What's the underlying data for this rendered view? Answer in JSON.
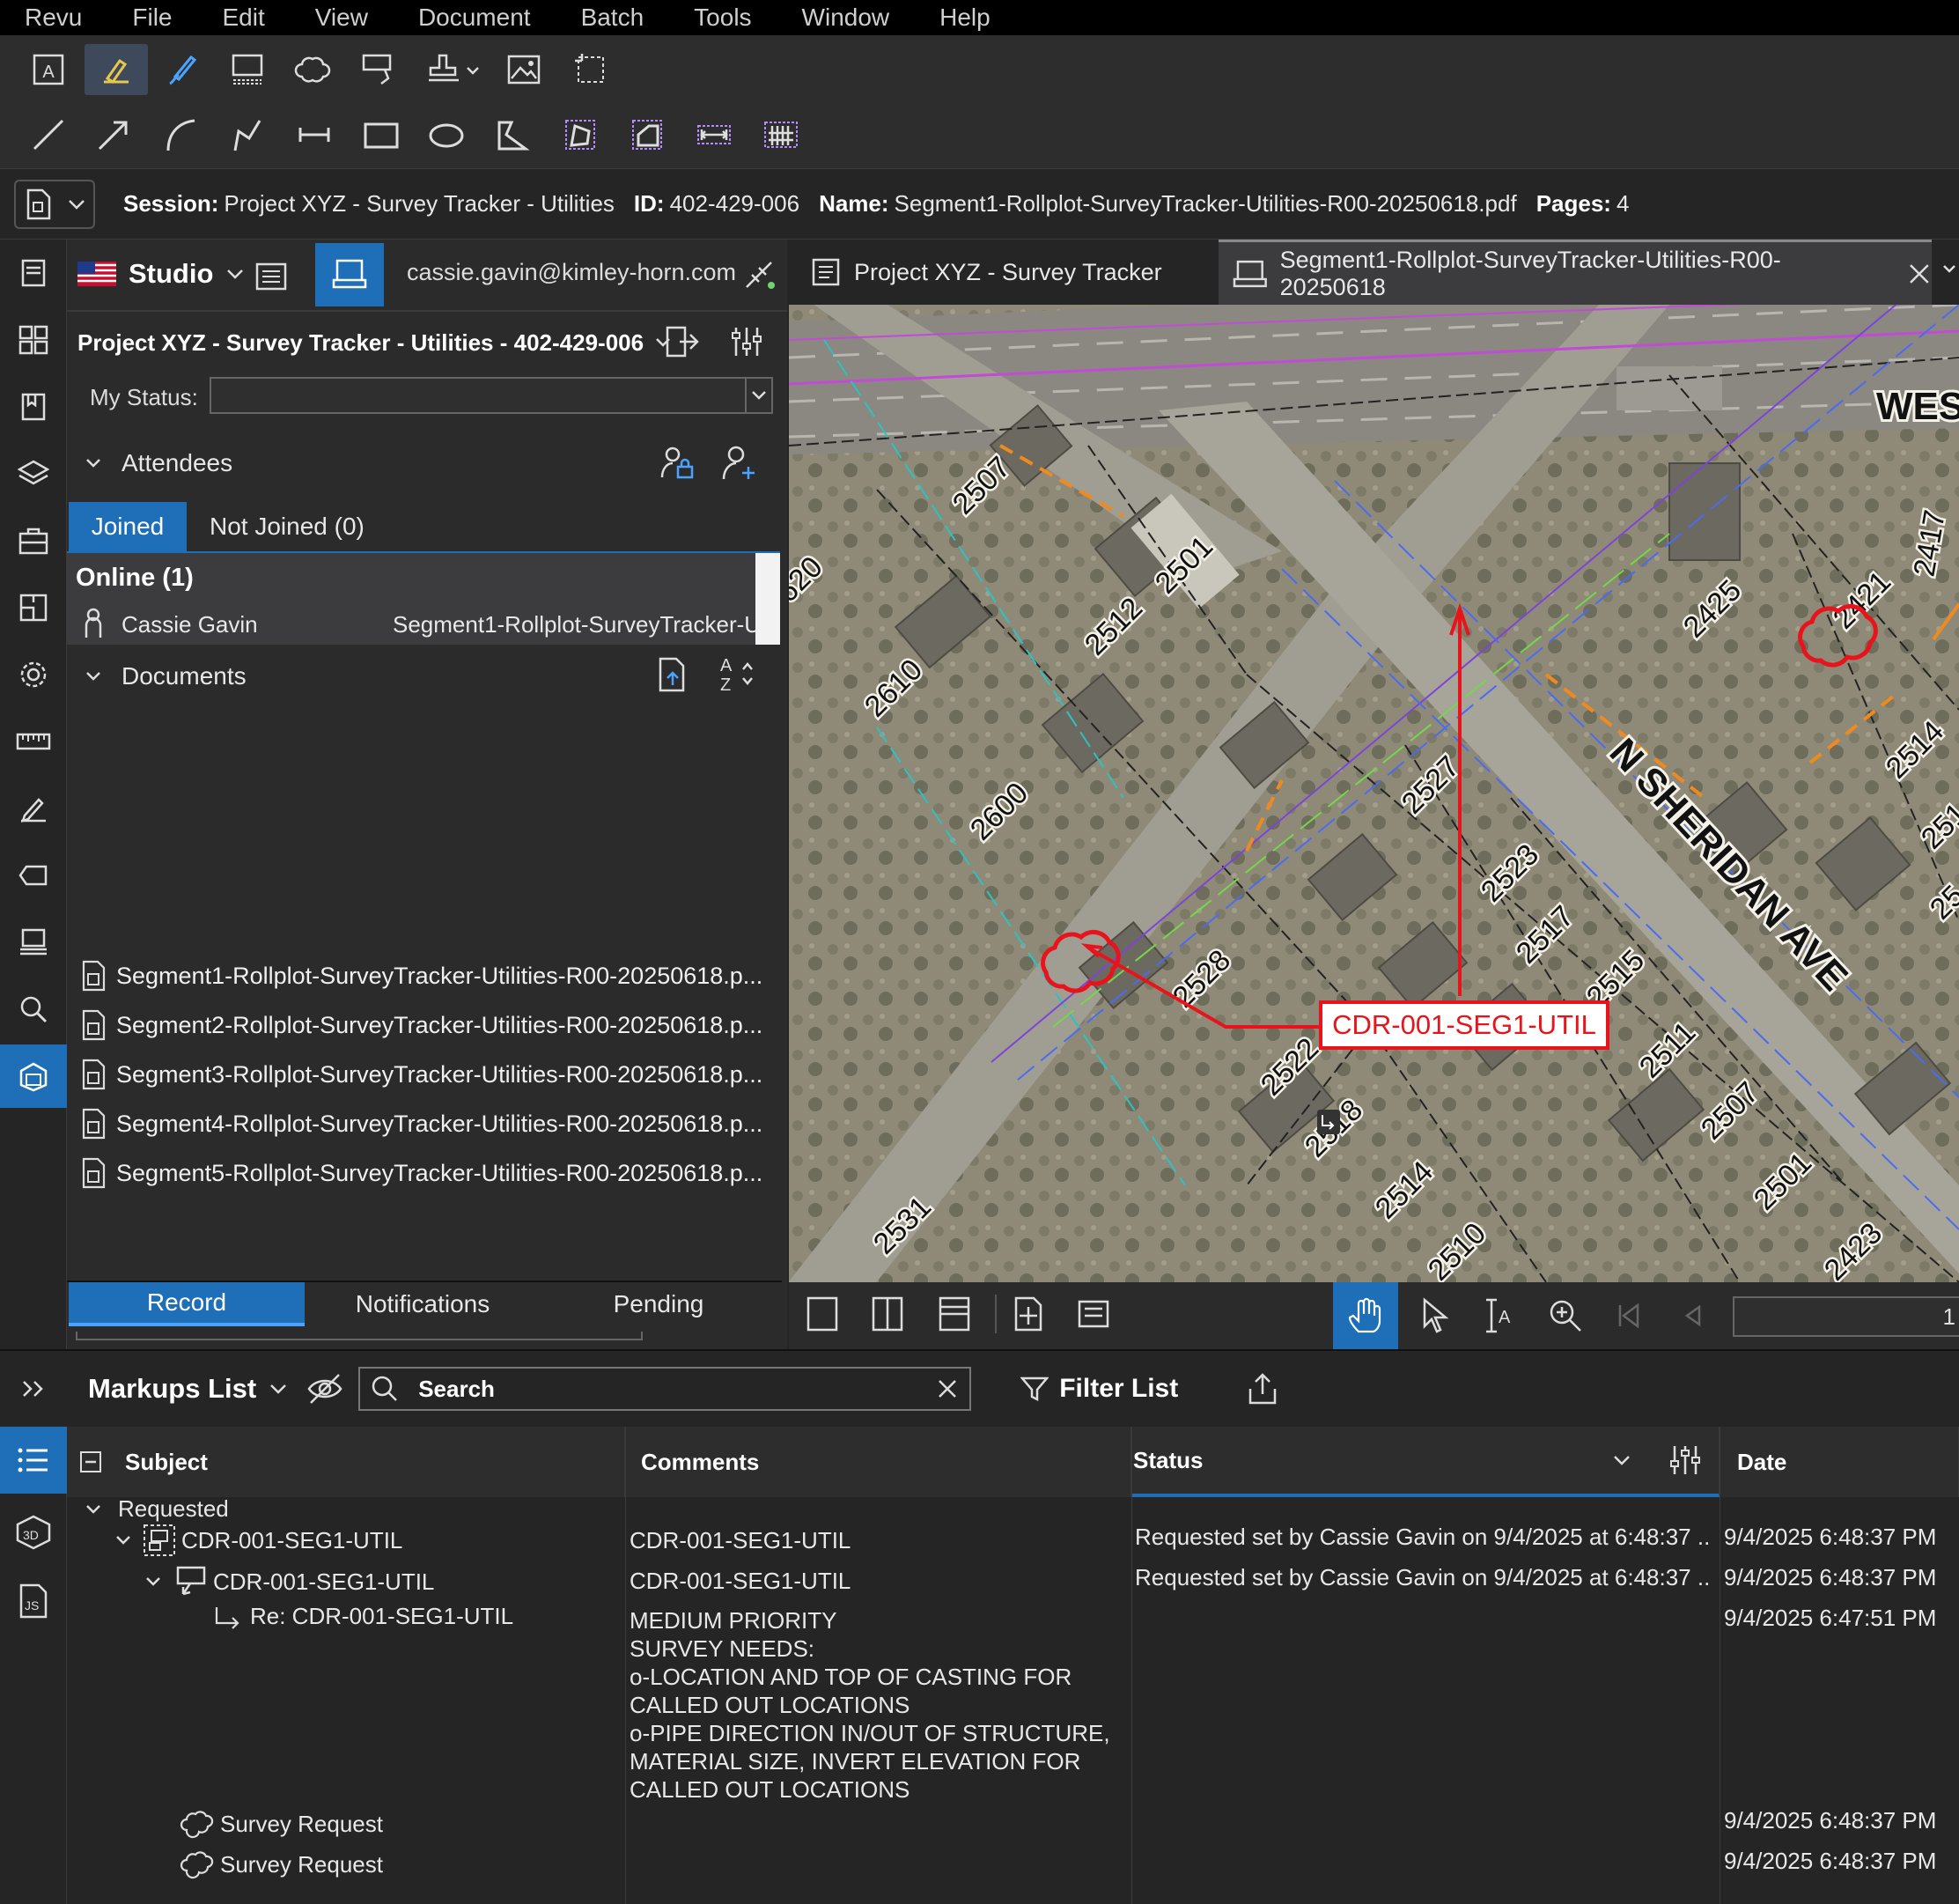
{
  "menu": [
    "Revu",
    "File",
    "Edit",
    "View",
    "Document",
    "Batch",
    "Tools",
    "Window",
    "Help"
  ],
  "info": {
    "session_label": "Session:",
    "session": "Project XYZ - Survey Tracker - Utilities",
    "id_label": "ID:",
    "id": "402-429-006",
    "name_label": "Name:",
    "name": "Segment1-Rollplot-SurveyTracker-Utilities-R00-20250618.pdf",
    "pages_label": "Pages:",
    "pages": "4"
  },
  "studio": {
    "title": "Studio",
    "user": "cassie.gavin@kimley-horn.com",
    "project": "Project XYZ - Survey Tracker - Utilities - 402-429-006",
    "my_status_label": "My Status:",
    "my_status_value": "",
    "attendees_label": "Attendees",
    "joined_tab": "Joined",
    "not_joined_tab": "Not Joined (0)",
    "online_header": "Online (1)",
    "attendee_name": "Cassie Gavin",
    "attendee_doc": "Segment1-Rollplot-SurveyTracker-U",
    "documents_label": "Documents",
    "documents": [
      "Segment1-Rollplot-SurveyTracker-Utilities-R00-20250618.p...",
      "Segment2-Rollplot-SurveyTracker-Utilities-R00-20250618.p...",
      "Segment3-Rollplot-SurveyTracker-Utilities-R00-20250618.p...",
      "Segment4-Rollplot-SurveyTracker-Utilities-R00-20250618.p...",
      "Segment5-Rollplot-SurveyTracker-Utilities-R00-20250618.p..."
    ],
    "bottom_tabs": [
      "Record",
      "Notifications",
      "Pending"
    ]
  },
  "tabs": [
    {
      "label": "Project XYZ - Survey Tracker"
    },
    {
      "label": "Segment1-Rollplot-SurveyTracker-Utilities-R00-20250618"
    }
  ],
  "map": {
    "callout": "CDR-001-SEG1-UTIL",
    "street": "N SHERIDAN AVE",
    "street2": "WES",
    "lots": [
      "2507",
      "2501",
      "2512",
      "2610",
      "2600",
      "2528",
      "2527",
      "2523",
      "2517",
      "2515",
      "2511",
      "2507",
      "2501",
      "2425",
      "2421",
      "2514",
      "2518",
      "2522",
      "2514",
      "2510",
      "2531",
      "2423",
      "620",
      "2417",
      "2514",
      "25"
    ]
  },
  "page_number": "1",
  "markups": {
    "title": "Markups List",
    "search_placeholder": "Search",
    "filter_label": "Filter List",
    "columns": [
      "Subject",
      "Comments",
      "Status",
      "Date"
    ],
    "group": "Requested",
    "rows": [
      {
        "subject": "CDR-001-SEG1-UTIL",
        "comment": "CDR-001-SEG1-UTIL",
        "status": "Requested set by Cassie Gavin on 9/4/2025 at 6:48:37 ...",
        "date": "9/4/2025 6:48:37 PM"
      },
      {
        "subject": "CDR-001-SEG1-UTIL",
        "comment": "CDR-001-SEG1-UTIL",
        "status": "Requested set by Cassie Gavin on 9/4/2025 at 6:48:37 ...",
        "date": "9/4/2025 6:48:37 PM"
      },
      {
        "subject": "Re: CDR-001-SEG1-UTIL",
        "comment_lines": [
          "MEDIUM PRIORITY",
          "SURVEY NEEDS:",
          "o-LOCATION AND TOP OF CASTING FOR",
          "CALLED OUT LOCATIONS",
          "o-PIPE DIRECTION IN/OUT OF STRUCTURE,",
          "MATERIAL SIZE, INVERT ELEVATION FOR",
          "CALLED OUT LOCATIONS"
        ],
        "status": "",
        "date": "9/4/2025 6:47:51 PM"
      },
      {
        "subject": "Survey Request",
        "comment": "",
        "status": "",
        "date": "9/4/2025 6:48:37 PM"
      },
      {
        "subject": "Survey Request",
        "comment": "",
        "status": "",
        "date": "9/4/2025 6:48:37 PM"
      }
    ]
  },
  "colors": {
    "accent": "#1e6fb8",
    "markup_red": "#e8141b",
    "bg": "#252526"
  }
}
